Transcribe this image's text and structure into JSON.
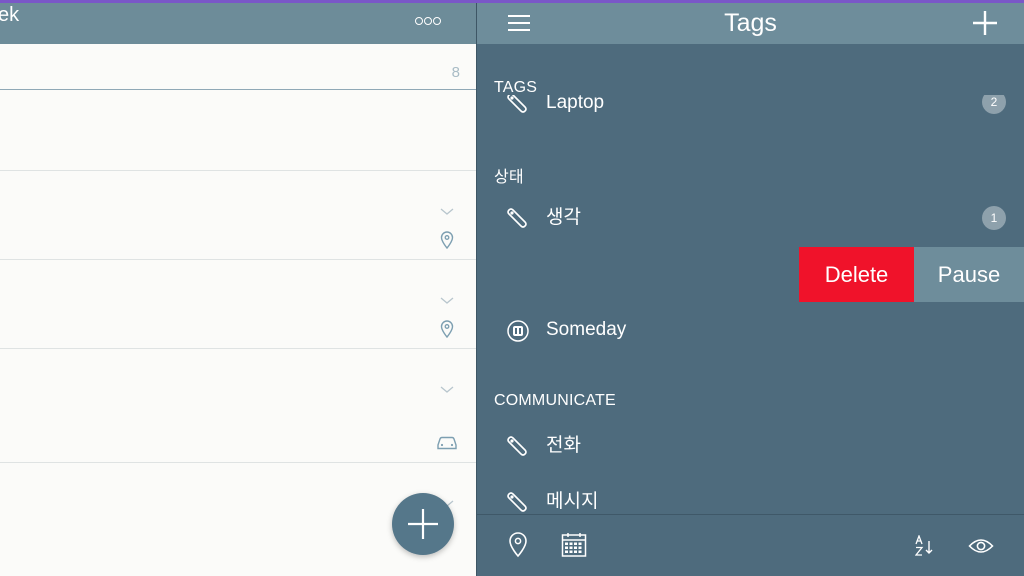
{
  "left_pane": {
    "title": "ek",
    "first_row_count": "8"
  },
  "right_pane": {
    "title": "Tags",
    "sections": {
      "tags": "TAGS",
      "status": "상태",
      "communicate": "COMMUNICATE"
    },
    "items": {
      "laptop": {
        "label": "Laptop",
        "count": "2"
      },
      "think": {
        "label": "생각",
        "count": "1"
      },
      "someday": {
        "label": "Someday"
      },
      "phone": {
        "label": "전화"
      },
      "message": {
        "label": "메시지"
      }
    },
    "swipe_actions": {
      "delete": "Delete",
      "pause": "Pause"
    },
    "toolbar": {
      "icons": [
        "location-pin-icon",
        "calendar-icon",
        "sort-az-icon",
        "eye-icon"
      ]
    }
  },
  "colors": {
    "header": "#6e8d9b",
    "panel": "#4e6b7d",
    "delete": "#f0122a",
    "accent_top": "#7a57c8"
  }
}
